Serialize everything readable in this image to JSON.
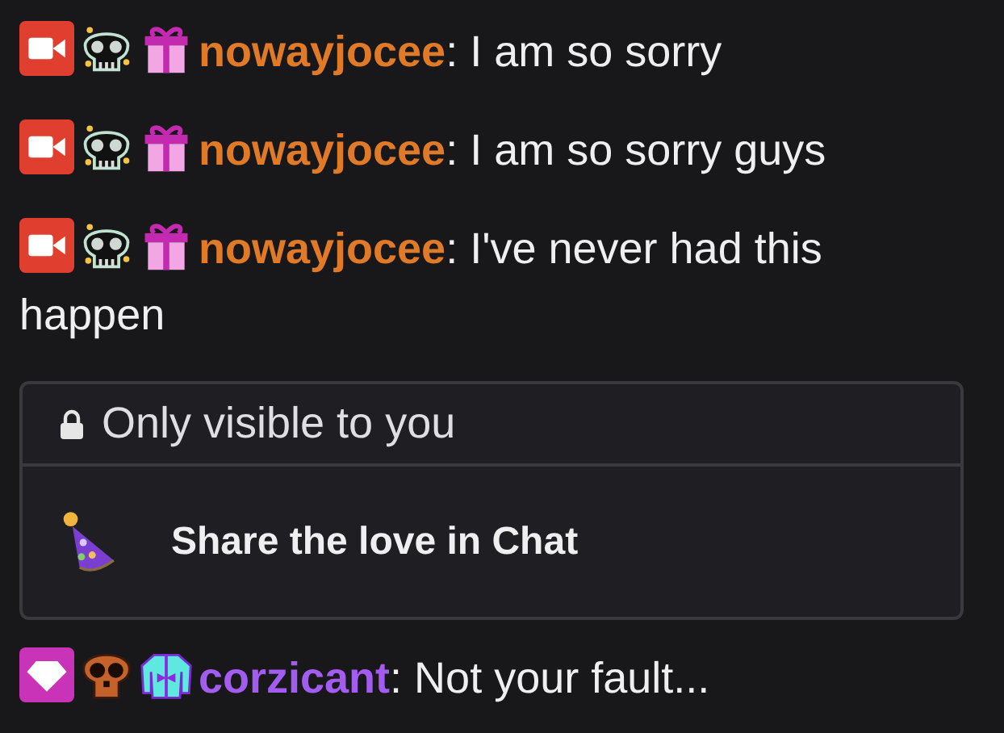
{
  "messages_top": [
    {
      "badges": [
        {
          "kind": "camera"
        },
        {
          "kind": "skull"
        },
        {
          "kind": "gift"
        }
      ],
      "username": "nowayjocee",
      "color": "#e07a26",
      "text": ": I am so sorry"
    },
    {
      "badges": [
        {
          "kind": "camera"
        },
        {
          "kind": "skull"
        },
        {
          "kind": "gift"
        }
      ],
      "username": "nowayjocee",
      "color": "#e07a26",
      "text": ": I am so sorry guys"
    },
    {
      "badges": [
        {
          "kind": "camera"
        },
        {
          "kind": "skull"
        },
        {
          "kind": "gift"
        }
      ],
      "username": "nowayjocee",
      "color": "#e07a26",
      "text": ": I've never had this happen"
    }
  ],
  "notice": {
    "header": "Only visible to you",
    "action": "Share the love in Chat"
  },
  "messages_bottom": [
    {
      "badges": [
        {
          "kind": "gem"
        },
        {
          "kind": "orange-skull"
        },
        {
          "kind": "sweater"
        }
      ],
      "username": "corzicant",
      "color": "#a25cf0",
      "text": ": Not your fault..."
    }
  ]
}
